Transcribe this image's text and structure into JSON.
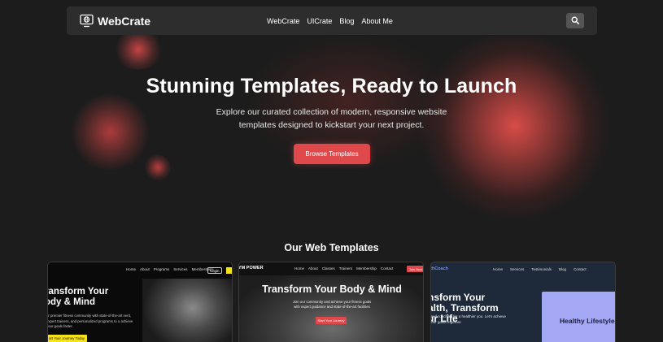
{
  "nav": {
    "brand": "WebCrate",
    "links": [
      "WebCrate",
      "UICrate",
      "Blog",
      "About Me"
    ],
    "search_icon": "search-icon",
    "logo_icon": "monitor-globe-icon"
  },
  "hero": {
    "title": "Stunning Templates, Ready to Launch",
    "subtitle_line1": "Explore our curated collection of modern, responsive website",
    "subtitle_line2": "templates designed to kickstart your next project.",
    "cta": "Browse Templates"
  },
  "section_title": "Our Web Templates",
  "templates": [
    {
      "nav": [
        "Home",
        "About",
        "Programs",
        "Services",
        "Memberships"
      ],
      "login": "Login",
      "title": "ransform Your\nody & Mind",
      "text": "ur premier fitness community with state-of-the-art nent, expert trainers, and personalized programs to u achieve your goals faster.",
      "cta": "art Your Journey Today"
    },
    {
      "brand": "YM POWER",
      "nav": [
        "Home",
        "About",
        "Classes",
        "Trainers",
        "Membership",
        "Contact"
      ],
      "nav_btn": "Join Now",
      "title": "Transform Your Body & Mind",
      "text": "Join our community and achieve your fitness goals with expert guidance and state-of-the-art facilities",
      "cta": "Start Your Journey"
    },
    {
      "brand": "thCoach",
      "nav": [
        "Home",
        "Services",
        "Testimonials",
        "Blog",
        "Contact"
      ],
      "title": "nsform Your\nalth, Transform\nur Life",
      "text": "rsed coaching for a healthier you. Let's achieve your goals together.",
      "panel": "Healthy Lifestyle"
    }
  ],
  "colors": {
    "background": "#1c1c1c",
    "navbar": "#2d2d2d",
    "accent": "#e0494c",
    "template1_accent": "#f5e21a",
    "template3_accent": "#a5a9f5"
  }
}
